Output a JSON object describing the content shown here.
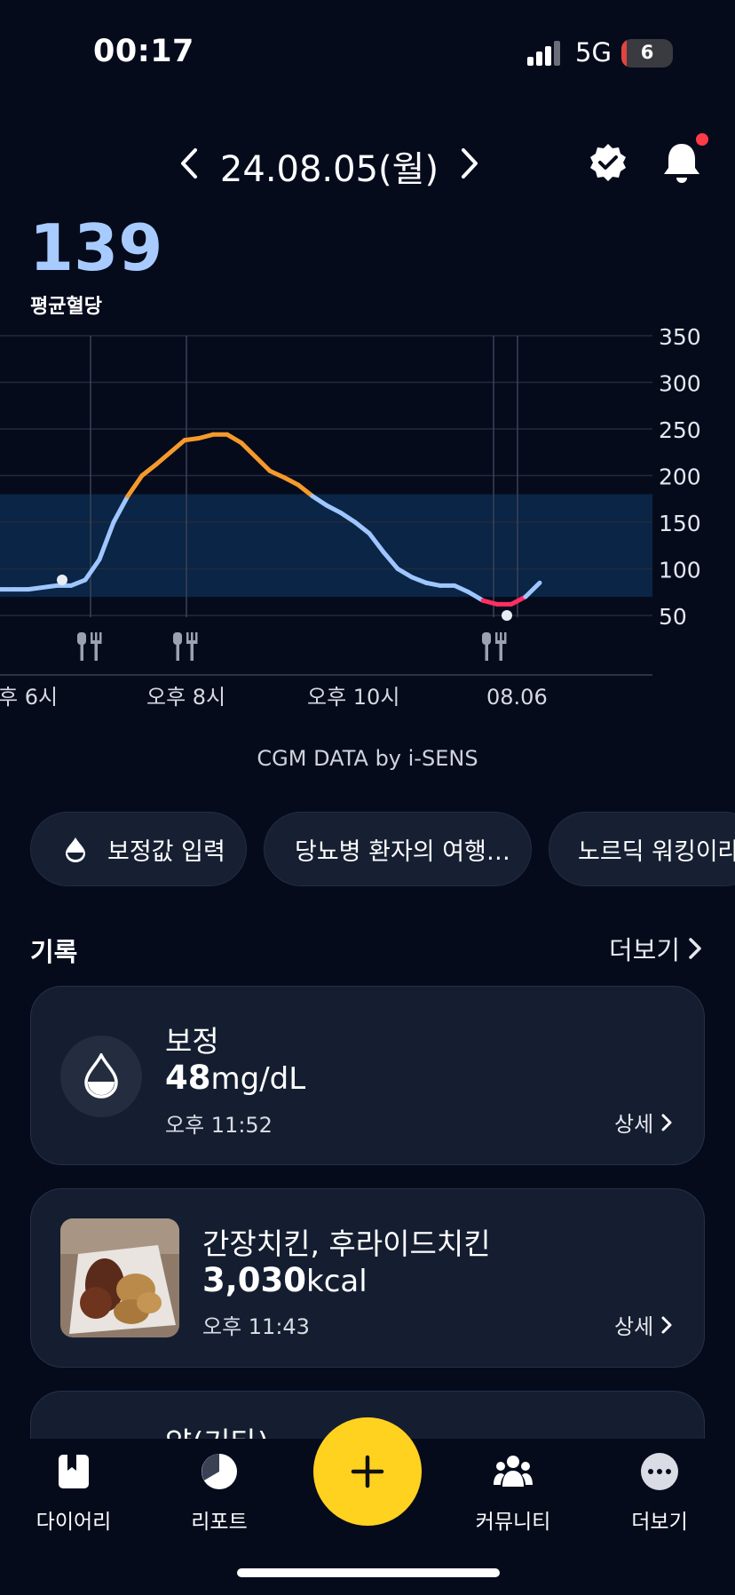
{
  "status_bar": {
    "time": "00:17",
    "network": "5G",
    "battery": "6"
  },
  "header": {
    "date": "24.08.05(월)"
  },
  "summary": {
    "avg_value": "139",
    "avg_label": "평균혈당"
  },
  "chart_data": {
    "type": "line",
    "yticks": [
      "350",
      "300",
      "250",
      "200",
      "150",
      "100",
      "50"
    ],
    "ylim": [
      50,
      350
    ],
    "target_range": [
      70,
      180
    ],
    "xticks": [
      "후 6시",
      "오후 8시",
      "오후 10시",
      "08.06"
    ],
    "meals": [
      "meal-1",
      "meal-2",
      "meal-3"
    ],
    "series": [
      {
        "values": [
          78,
          78,
          78,
          80,
          82,
          82,
          88,
          110,
          150,
          178,
          200,
          212,
          225,
          238,
          240,
          244,
          244,
          235,
          220,
          205,
          198,
          190,
          178,
          168,
          160,
          150,
          138,
          118,
          100,
          91,
          85,
          82,
          82,
          75,
          66,
          62,
          62,
          70,
          85
        ]
      }
    ],
    "colors": {
      "normal": "#9fc6ff",
      "high": "#f59a2a",
      "low": "#ff2f62",
      "range": "#0a2545"
    }
  },
  "credit": "CGM DATA by i-SENS",
  "chips": [
    {
      "label": "보정값 입력"
    },
    {
      "label": "당뇨병 환자의 여행…"
    },
    {
      "label": "노르딕 워킹이라고"
    }
  ],
  "records": {
    "title": "기록",
    "more": "더보기",
    "items": [
      {
        "title": "보정",
        "value": "48",
        "unit": "mg/dL",
        "time": "오후 11:52",
        "detail": "상세"
      },
      {
        "title": "간장치킨, 후라이드치킨",
        "value": "3,030",
        "unit": "kcal",
        "time": "오후 11:43",
        "detail": "상세"
      },
      {
        "title": "약(기타)"
      }
    ]
  },
  "nav": {
    "diary": "다이어리",
    "report": "리포트",
    "community": "커뮤니티",
    "more": "더보기"
  }
}
